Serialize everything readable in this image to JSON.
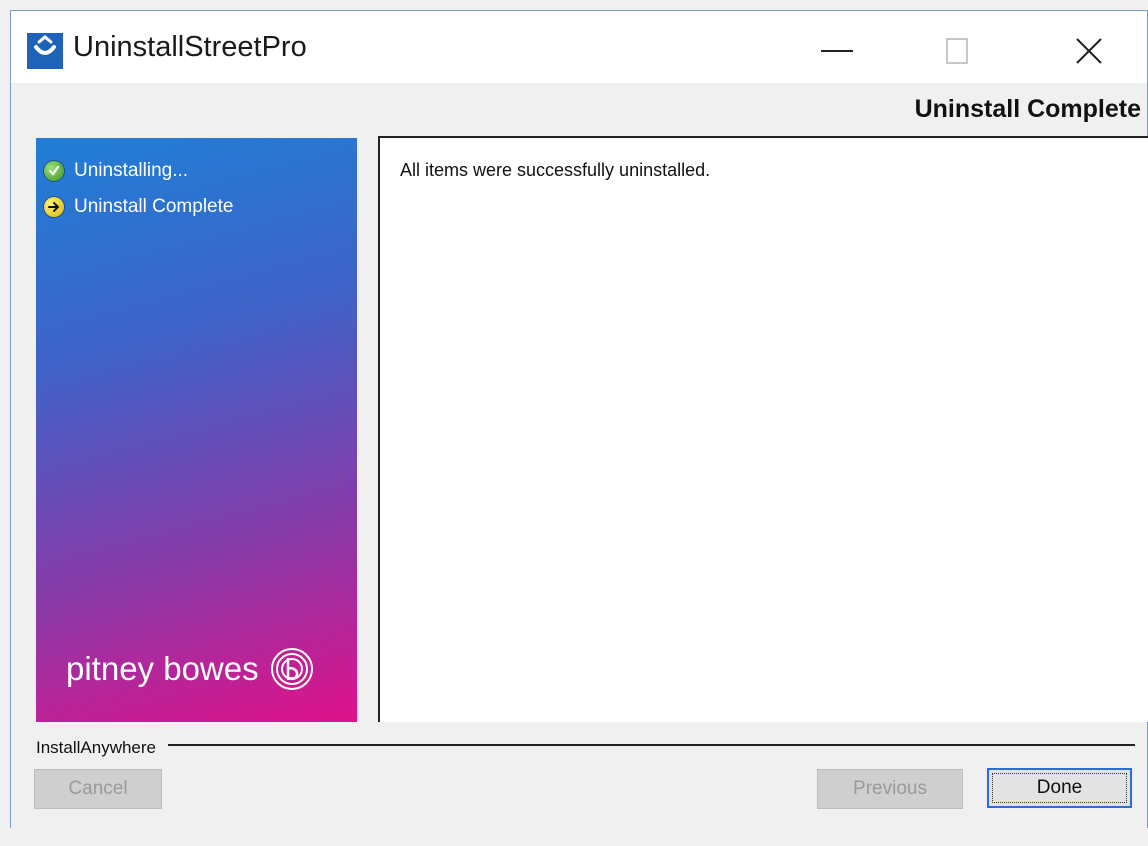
{
  "window": {
    "title": "UninstallStreetPro",
    "icon": "app-installer-icon",
    "controls": [
      "minimize-icon",
      "maximize-icon",
      "close-icon"
    ]
  },
  "header": {
    "step_title": "Uninstall Complete"
  },
  "sidebar": {
    "steps": [
      {
        "label": "Uninstalling...",
        "status_icon": "check-circle-icon",
        "status": "done"
      },
      {
        "label": "Uninstall Complete",
        "status_icon": "arrow-circle-icon",
        "status": "current"
      }
    ],
    "logo_text": "pitney bowes",
    "colors": {
      "gradient_start": "#1f7fd6",
      "gradient_end": "#e0118a"
    }
  },
  "main": {
    "message": "All items were successfully uninstalled."
  },
  "footer": {
    "brand_label": "InstallAnywhere",
    "buttons": {
      "cancel": "Cancel",
      "previous": "Previous",
      "done": "Done"
    }
  }
}
